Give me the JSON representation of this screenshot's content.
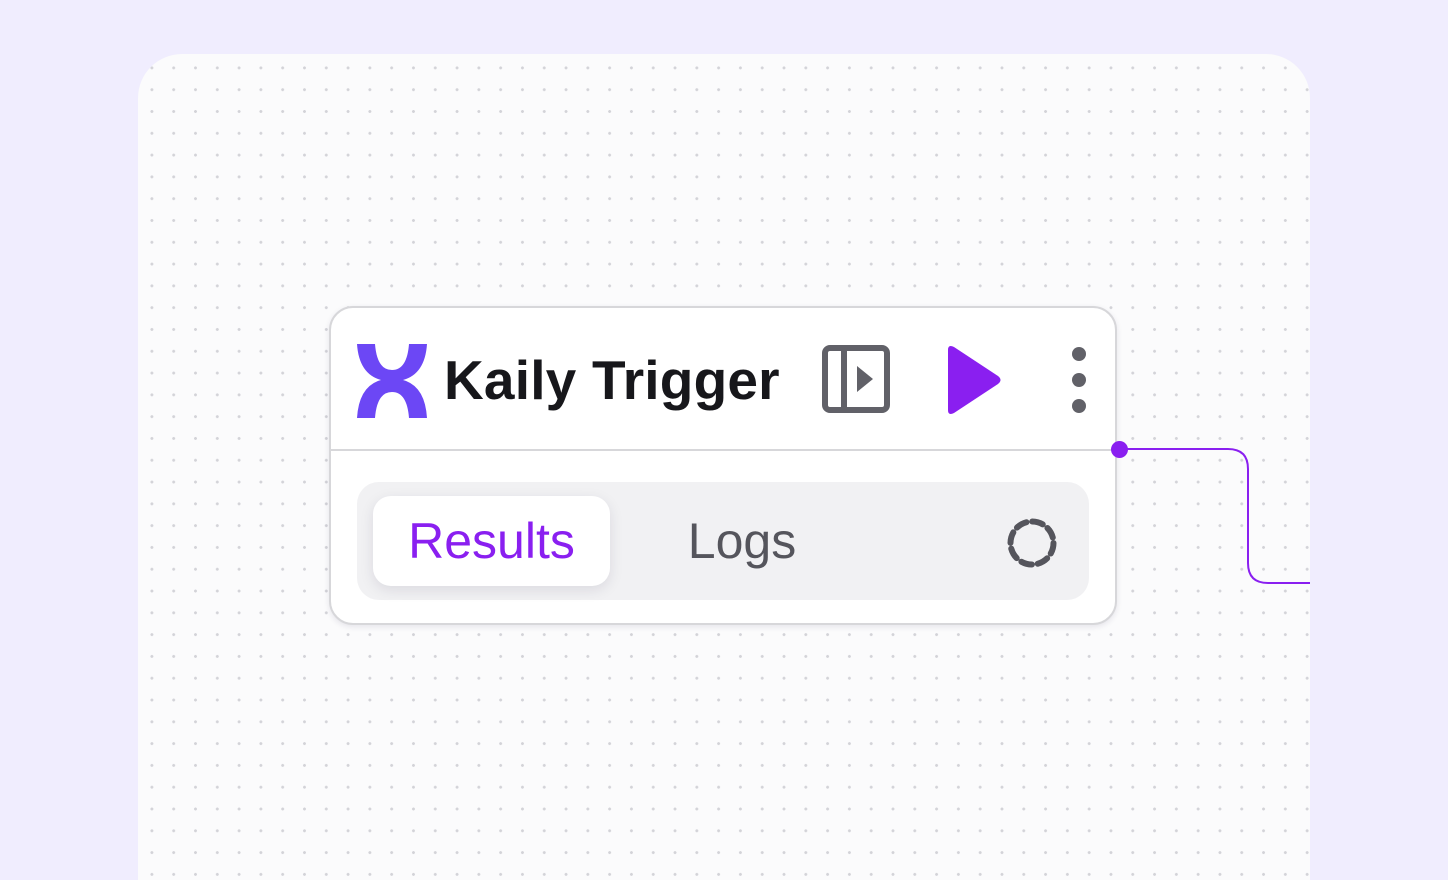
{
  "node": {
    "title": "Kaily Trigger",
    "brand_icon": "kaily-logo-icon",
    "actions": [
      {
        "name": "open-panel",
        "icon": "side-panel-icon"
      },
      {
        "name": "run",
        "icon": "play-icon"
      },
      {
        "name": "more",
        "icon": "more-vertical-icon"
      }
    ],
    "tabs": [
      {
        "label": "Results",
        "active": true
      },
      {
        "label": "Logs",
        "active": false
      }
    ],
    "status_icon": "loading-spinner-icon"
  },
  "colors": {
    "page_background": "#f0edfe",
    "canvas_background": "#fbfbfc",
    "brand": "#6c47f5",
    "accent": "#8a1ff0",
    "icon_gray": "#616168",
    "border": "#d7d7da",
    "title": "#17171b"
  }
}
